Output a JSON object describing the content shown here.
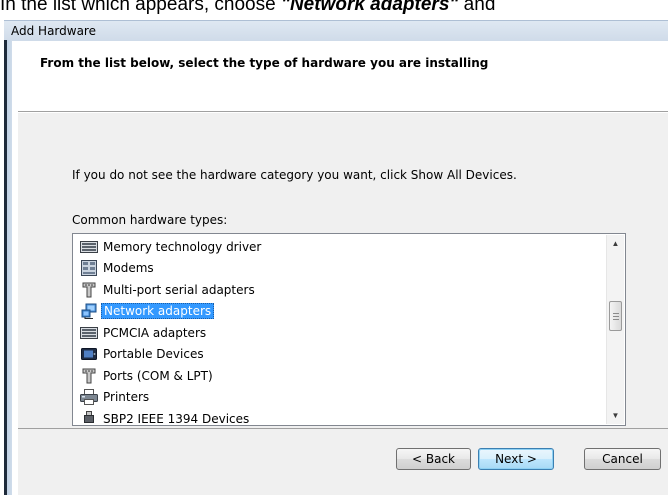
{
  "caption": {
    "prefix": "In the list which appears, choose ",
    "emphasis": "\"Network adapters\"",
    "suffix": " and"
  },
  "window": {
    "title": "Add Hardware"
  },
  "header": {
    "instruction": "From the list below, select the type of hardware you are installing"
  },
  "content": {
    "info": "If you do not see the hardware category you want, click Show All Devices.",
    "list_label": "Common hardware types:",
    "items": [
      {
        "label": "Memory technology driver",
        "icon": "memory-device-icon"
      },
      {
        "label": "Modems",
        "icon": "modem-icon"
      },
      {
        "label": "Multi-port serial adapters",
        "icon": "serial-port-icon"
      },
      {
        "label": "Network adapters",
        "icon": "network-adapter-icon",
        "selected": true
      },
      {
        "label": "PCMCIA adapters",
        "icon": "pcmcia-card-icon"
      },
      {
        "label": "Portable Devices",
        "icon": "portable-device-icon"
      },
      {
        "label": "Ports (COM & LPT)",
        "icon": "port-icon"
      },
      {
        "label": "Printers",
        "icon": "printer-icon"
      },
      {
        "label": "SBP2 IEEE 1394 Devices",
        "icon": "usb-plug-icon"
      }
    ]
  },
  "buttons": {
    "back": "< Back",
    "next": "Next >",
    "cancel": "Cancel"
  }
}
